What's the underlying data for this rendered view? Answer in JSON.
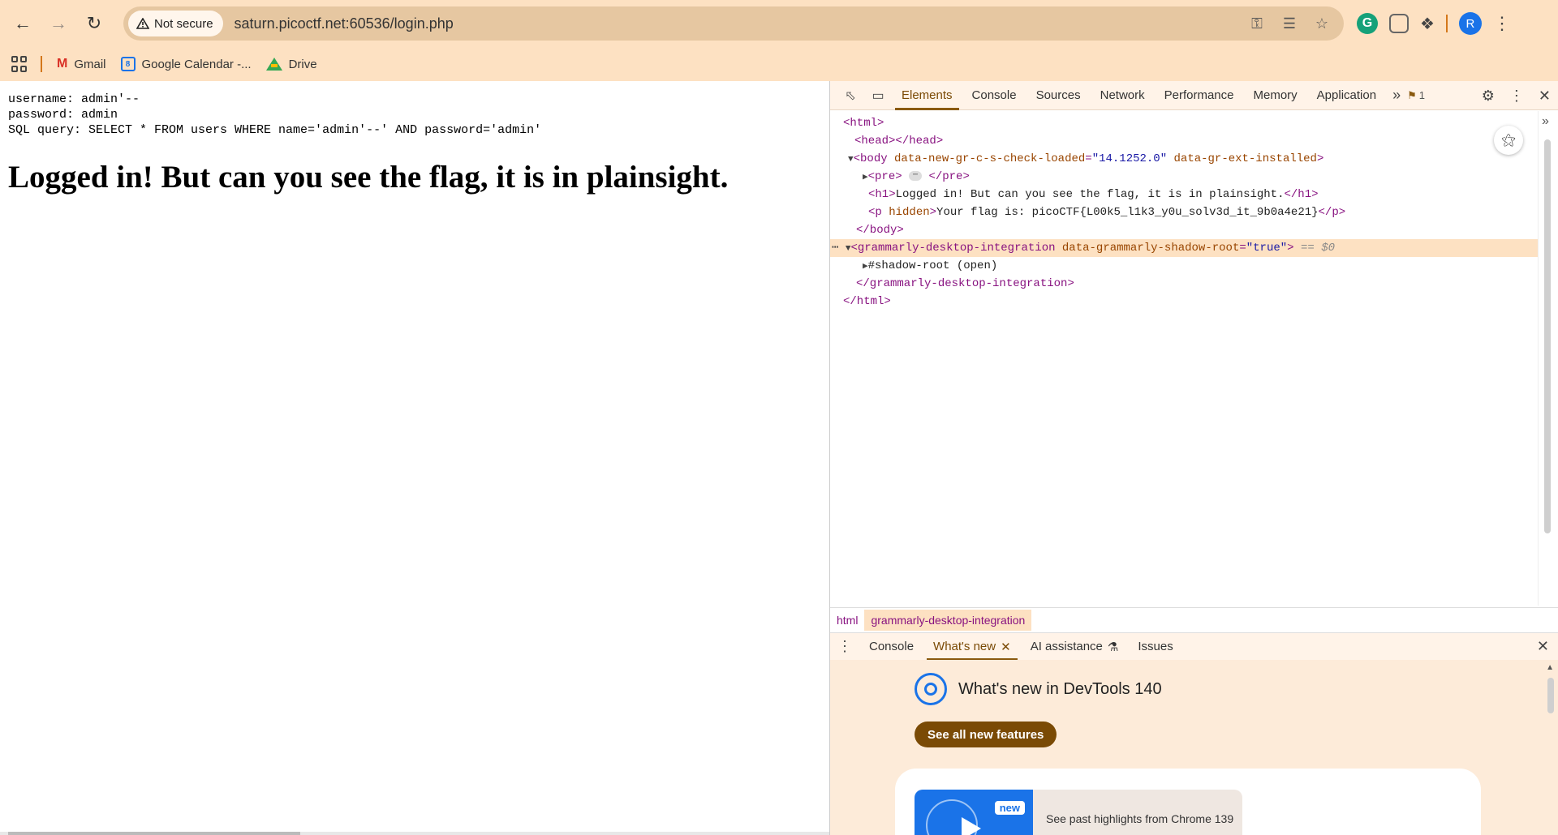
{
  "browser": {
    "security_label": "Not secure",
    "url": "saturn.picoctf.net:60536/login.php",
    "profile_initial": "R",
    "bookmarks": [
      {
        "label": "Gmail"
      },
      {
        "label": "Google Calendar -..."
      },
      {
        "label": "Drive"
      }
    ]
  },
  "page": {
    "pre_lines": [
      "username: admin'--",
      "password: admin",
      "SQL query: SELECT * FROM users WHERE name='admin'--' AND password='admin'"
    ],
    "heading": "Logged in! But can you see the flag, it is in plainsight."
  },
  "devtools": {
    "tabs": [
      "Elements",
      "Console",
      "Sources",
      "Network",
      "Performance",
      "Memory",
      "Application"
    ],
    "issues_count": "1",
    "dom": {
      "html_open": "<html>",
      "head": "<head></head>",
      "body_tag": "<body",
      "body_attr1": "data-new-gr-c-s-check-loaded",
      "body_val1": "\"14.1252.0\"",
      "body_attr2": "data-gr-ext-installed",
      "pre_open": "<pre>",
      "pre_close": "</pre>",
      "h1_open": "<h1>",
      "h1_text": "Logged in! But can you see the flag, it is in plainsight.",
      "h1_close": "</h1>",
      "p_open": "<p",
      "p_attr": "hidden",
      "p_text": "Your flag is: picoCTF{L00k5_l1k3_y0u_solv3d_it_9b0a4e21}",
      "p_close": "</p>",
      "body_close": "</body>",
      "gr_tag": "<grammarly-desktop-integration",
      "gr_attr": "data-grammarly-shadow-root",
      "gr_val": "\"true\"",
      "gr_dollar": "== $0",
      "shadow": "#shadow-root (open)",
      "gr_close": "</grammarly-desktop-integration>",
      "html_close": "</html>"
    },
    "breadcrumbs": [
      "html",
      "grammarly-desktop-integration"
    ],
    "drawer_tabs": [
      "Console",
      "What's new",
      "AI assistance",
      "Issues"
    ],
    "whats_new_title": "What's new in DevTools 140",
    "see_all_label": "See all new features",
    "highlight_badge": "new",
    "highlight_text": "See past highlights from Chrome 139"
  }
}
